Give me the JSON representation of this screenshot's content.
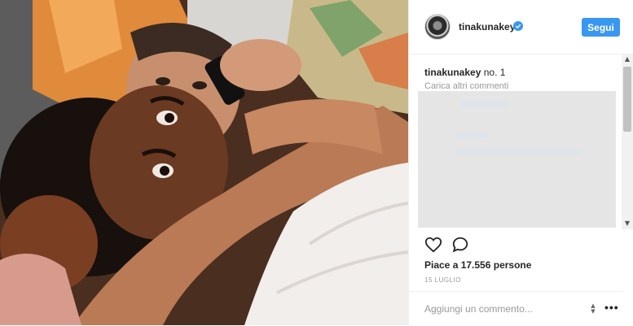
{
  "post": {
    "username": "tinakunakey",
    "follow_label": "Segui",
    "caption_user": "tinakunakey",
    "caption_text": "no. 1",
    "load_more": "Carica altri commenti",
    "likes": "Piace a 17.556 persone",
    "date": "15 LUGLIO",
    "comment_placeholder": "Aggiungi un commento...",
    "icons": {
      "verified": "verified-badge-icon",
      "like": "heart-icon",
      "comment": "speech-bubble-icon",
      "more": "ellipsis-icon"
    }
  },
  "colors": {
    "accent": "#3897f0",
    "text": "#262626",
    "muted": "#999999",
    "divider": "#efefef"
  }
}
